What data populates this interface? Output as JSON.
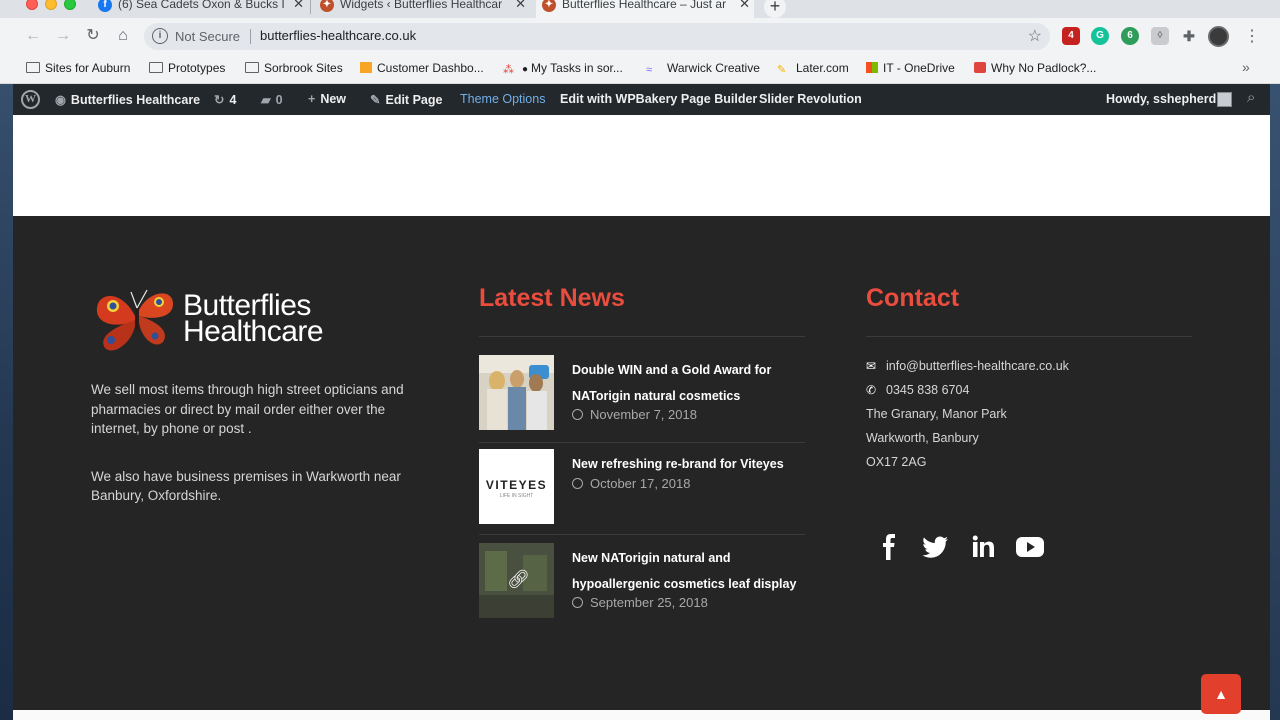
{
  "browser": {
    "tabs": [
      {
        "title": "(6) Sea Cadets Oxon & Bucks I",
        "favicon": "facebook-icon"
      },
      {
        "title": "Widgets ‹ Butterflies Healthcar",
        "favicon": "butterfly-icon"
      },
      {
        "title": "Butterflies Healthcare – Just ar",
        "favicon": "butterfly-icon",
        "active": true
      }
    ],
    "new_tab": "+",
    "address": {
      "security": "Not Secure",
      "url": "butterflies-healthcare.co.uk"
    },
    "extension_badges": [
      "4",
      "6"
    ],
    "bookmarks": [
      "Sites for Auburn",
      "Prototypes",
      "Sorbrook Sites",
      "Customer Dashbo...",
      "My Tasks in sor...",
      "Warwick Creative",
      "Later.com",
      "IT - OneDrive",
      "Why No Padlock?..."
    ]
  },
  "wp_admin_bar": {
    "site": "Butterflies Healthcare",
    "updates": "4",
    "comments": "0",
    "new": "New",
    "edit_page": "Edit Page",
    "theme_options": "Theme Options",
    "wpbakery": "Edit with WPBakery Page Builder",
    "slider": "Slider Revolution",
    "howdy": "Howdy, sshepherd"
  },
  "footer": {
    "brand": {
      "line1": "Butterflies",
      "line2": "Healthcare"
    },
    "about": [
      "We sell most items through high street opticians and pharmacies or direct by mail order either over the internet, by phone or post .",
      "We also have business premises in Warkworth near Banbury, Oxfordshire."
    ],
    "news": {
      "title": "Latest News",
      "items": [
        {
          "title": "Double WIN and a Gold Award for NATorigin natural cosmetics",
          "date": "November 7, 2018"
        },
        {
          "title": "New refreshing re-brand for Viteyes",
          "date": "October 17, 2018",
          "thumb_text": "VITEYES",
          "thumb_sub": "LIFE IN SIGHT"
        },
        {
          "title": "New NATorigin natural and hypoallergenic cosmetics leaf display",
          "date": "September 25, 2018"
        }
      ]
    },
    "contact": {
      "title": "Contact",
      "email": "info@butterflies-healthcare.co.uk",
      "phone": "0345 838 6704",
      "address": [
        "The Granary, Manor Park",
        "Warkworth, Banbury",
        "OX17 2AG"
      ]
    },
    "social": [
      "facebook-icon",
      "twitter-icon",
      "linkedin-icon",
      "youtube-icon"
    ]
  },
  "colors": {
    "accent": "#ea4d3d",
    "footer_bg": "#252525",
    "wp_bar": "#23282d",
    "wp_highlight": "#72aee6"
  }
}
